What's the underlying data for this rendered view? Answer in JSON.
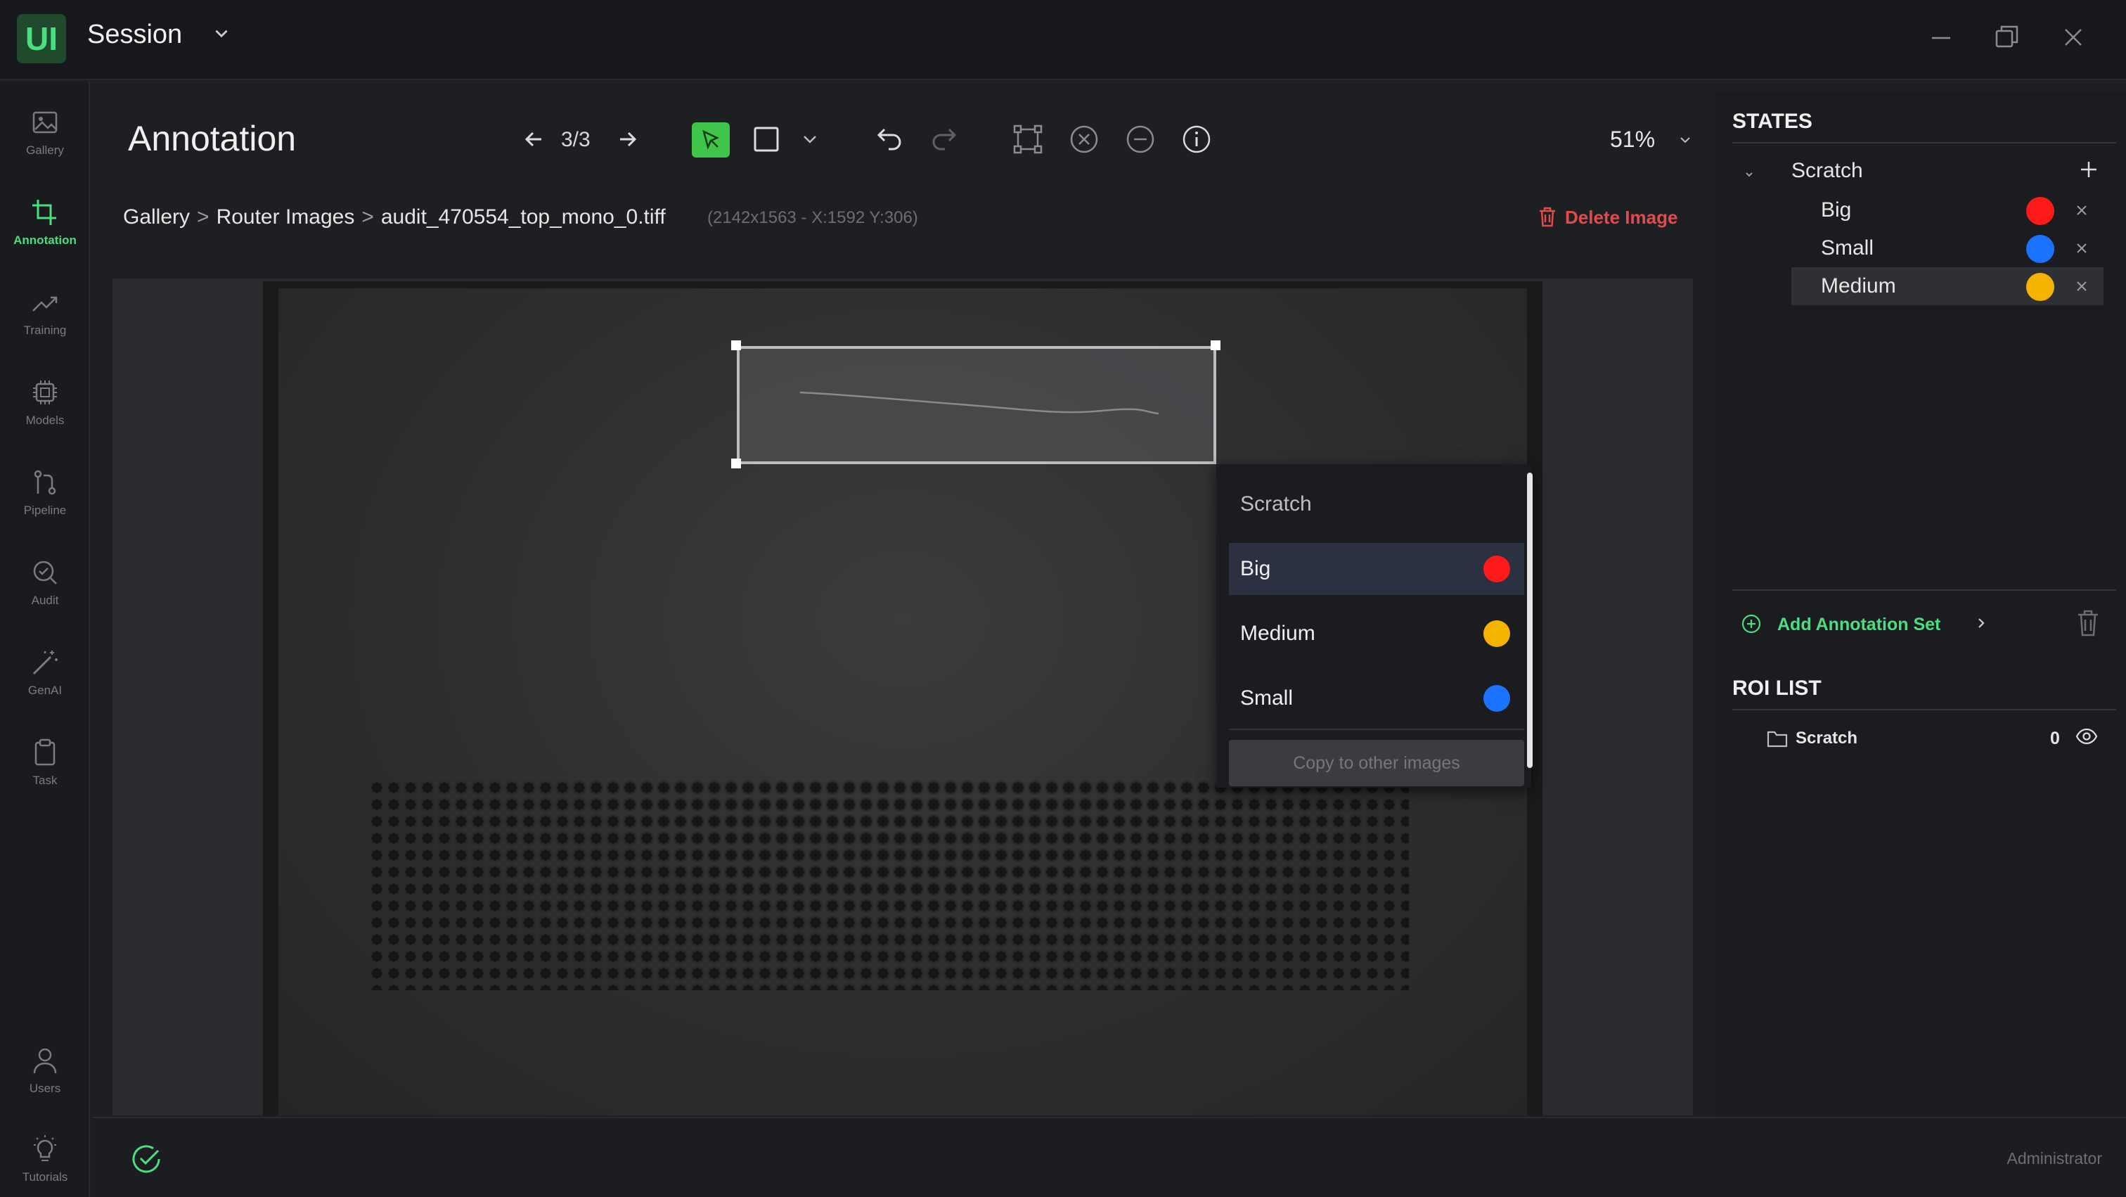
{
  "app": {
    "logo_text": "UI",
    "session_title": "Session",
    "accent_color": "#4ade80",
    "danger_color": "#e24b4b"
  },
  "nav": [
    {
      "label": "Gallery",
      "icon": "image-icon",
      "active": false
    },
    {
      "label": "Annotation",
      "icon": "crop-icon",
      "active": true
    },
    {
      "label": "Training",
      "icon": "trend-icon",
      "active": false
    },
    {
      "label": "Models",
      "icon": "chip-icon",
      "active": false
    },
    {
      "label": "Pipeline",
      "icon": "pipeline-icon",
      "active": false
    },
    {
      "label": "Audit",
      "icon": "audit-icon",
      "active": false
    },
    {
      "label": "GenAI",
      "icon": "wand-icon",
      "active": false
    },
    {
      "label": "Task",
      "icon": "clipboard-icon",
      "active": false
    },
    {
      "label": "Users",
      "icon": "user-icon",
      "active": false
    },
    {
      "label": "Tutorials",
      "icon": "bulb-icon",
      "active": false
    }
  ],
  "header": {
    "page_title": "Annotation",
    "page_counter": "3/3",
    "zoom": "51%"
  },
  "breadcrumb": {
    "items": [
      "Gallery",
      "Router Images",
      "audit_470554_top_mono_0.tiff"
    ],
    "separator": ">",
    "image_meta": "(2142x1563 - X:1592 Y:306)"
  },
  "delete_image_label": "Delete Image",
  "popup": {
    "title": "Scratch",
    "options": [
      {
        "label": "Big",
        "color": "#ff1a1a",
        "selected": true
      },
      {
        "label": "Medium",
        "color": "#f5b300",
        "selected": false
      },
      {
        "label": "Small",
        "color": "#1a73ff",
        "selected": false
      }
    ],
    "copy_label": "Copy to other images"
  },
  "states": {
    "title": "STATES",
    "group": "Scratch",
    "items": [
      {
        "label": "Big",
        "color": "#ff1a1a",
        "selected": false
      },
      {
        "label": "Small",
        "color": "#1a73ff",
        "selected": false
      },
      {
        "label": "Medium",
        "color": "#f5b300",
        "selected": true
      }
    ],
    "add_set_label": "Add Annotation Set"
  },
  "roi": {
    "title": "ROI LIST",
    "items": [
      {
        "label": "Scratch",
        "count": "0"
      }
    ]
  },
  "status": {
    "user_role": "Administrator"
  }
}
